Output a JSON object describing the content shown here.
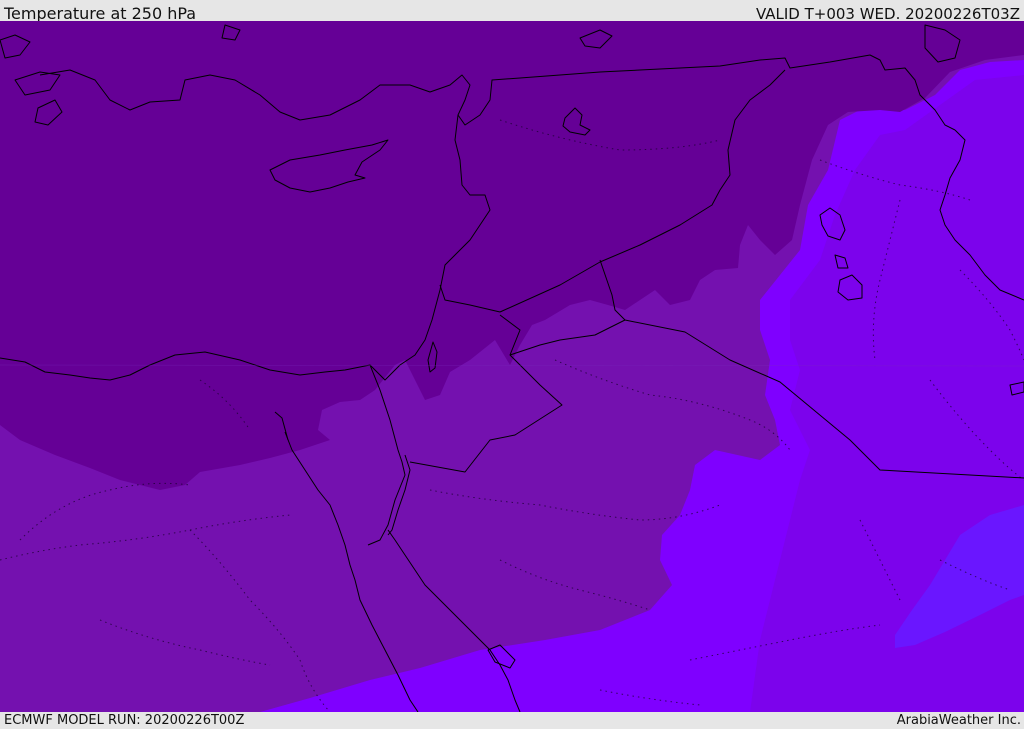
{
  "header": {
    "title": "Temperature at 250 hPa",
    "valid_time": "VALID T+003 WED. 20200226T03Z"
  },
  "footer": {
    "model_run": "ECMWF MODEL RUN: 20200226T00Z",
    "credit": "ArabiaWeather Inc."
  },
  "colors": {
    "band_darkest": "#650096",
    "band_dark": "#7411af",
    "band_mid": "#8000ee",
    "band_bright": "#7f00ff",
    "band_blue": "#6a16ff",
    "coastline": "#000000",
    "frame": "#e6e6e6"
  }
}
